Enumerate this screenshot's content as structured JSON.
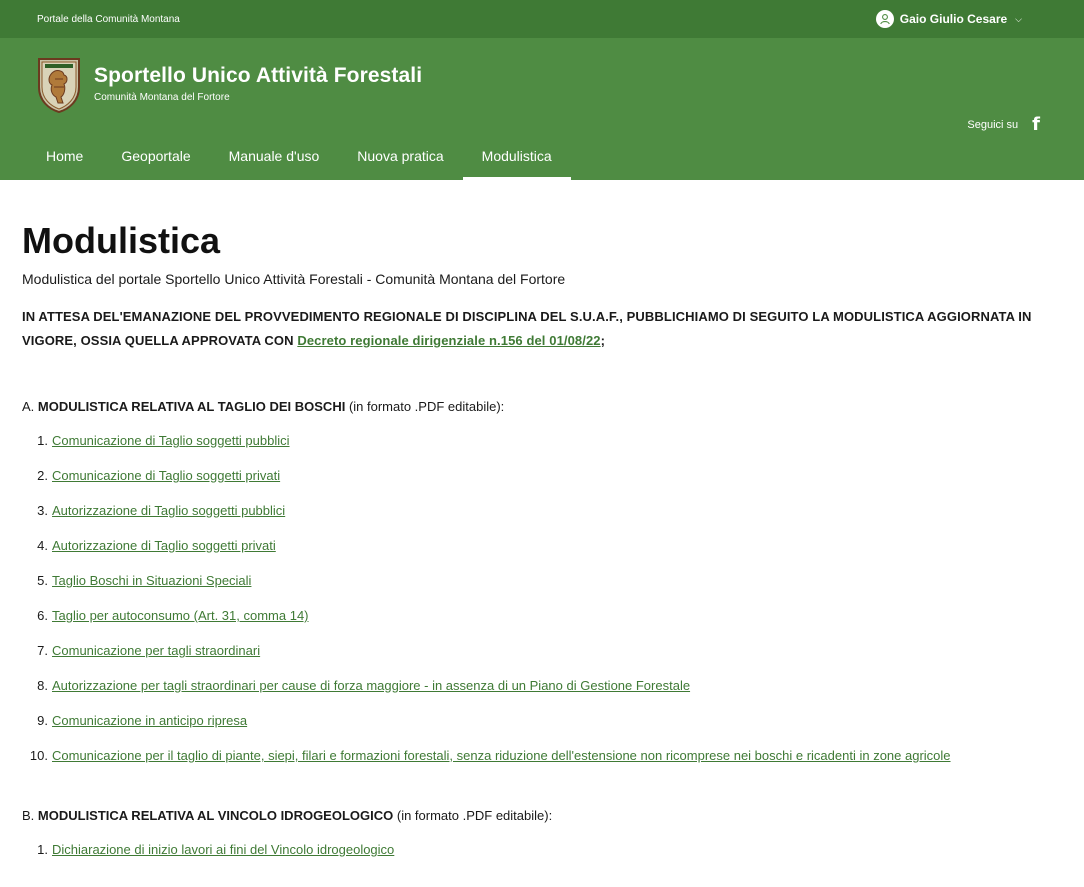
{
  "topbar": {
    "portal_link": "Portale della Comunità Montana",
    "user_name": "Gaio Giulio Cesare",
    "user_icon": "user-icon",
    "chevron": "⌵"
  },
  "header": {
    "title": "Sportello Unico Attività Forestali",
    "subtitle": "Comunità Montana del Fortore",
    "follow_label": "Seguici su",
    "facebook_glyph": "f"
  },
  "nav": {
    "items": [
      {
        "label": "Home"
      },
      {
        "label": "Geoportale"
      },
      {
        "label": "Manuale d'uso"
      },
      {
        "label": "Nuova pratica"
      },
      {
        "label": "Modulistica",
        "active": true
      }
    ]
  },
  "page": {
    "title": "Modulistica",
    "subtitle": "Modulistica del portale Sportello Unico Attività Forestali - Comunità Montana del Fortore",
    "notice_pre": "IN ATTESA DEL'EMANAZIONE DEL PROVVEDIMENTO REGIONALE DI DISCIPLINA DEL S.U.A.F., PUBBLICHIAMO DI SEGUITO LA MODULISTICA  AGGIORNATA IN VIGORE, OSSIA QUELLA APPROVATA CON ",
    "notice_link": "Decreto regionale dirigenziale n.156 del 01/08/22",
    "notice_post": ";"
  },
  "section_a": {
    "prefix": "A. ",
    "title": "MODULISTICA RELATIVA AL TAGLIO DEI BOSCHI",
    "suffix": " (in formato .PDF editabile):",
    "items": [
      {
        "num": "1.",
        "label": "Comunicazione di Taglio soggetti pubblici"
      },
      {
        "num": "2.",
        "label": "Comunicazione di Taglio soggetti privati"
      },
      {
        "num": "3.",
        "label": "Autorizzazione di Taglio soggetti pubblici"
      },
      {
        "num": "4.",
        "label": "Autorizzazione di Taglio soggetti privati"
      },
      {
        "num": "5.",
        "label": "Taglio Boschi in Situazioni Speciali"
      },
      {
        "num": "6.",
        "label": "Taglio per autoconsumo (Art. 31, comma 14)"
      },
      {
        "num": "7.",
        "label": "Comunicazione per tagli straordinari"
      },
      {
        "num": "8.",
        "label": "Autorizzazione per tagli straordinari per cause di forza maggiore - in assenza di un Piano di Gestione Forestale"
      },
      {
        "num": "9.",
        "label": "Comunicazione in anticipo ripresa"
      },
      {
        "num": "10.",
        "label": "Comunicazione per il taglio di piante, siepi, filari e formazioni forestali, senza riduzione dell'estensione non ricomprese nei boschi e ricadenti in zone agricole"
      }
    ]
  },
  "section_b": {
    "prefix": "B. ",
    "title": "MODULISTICA RELATIVA AL VINCOLO IDROGEOLOGICO",
    "suffix": " (in formato .PDF editabile):",
    "items": [
      {
        "num": "1.",
        "label": "Dichiarazione di inizio lavori ai fini del Vincolo idrogeologico"
      }
    ]
  }
}
